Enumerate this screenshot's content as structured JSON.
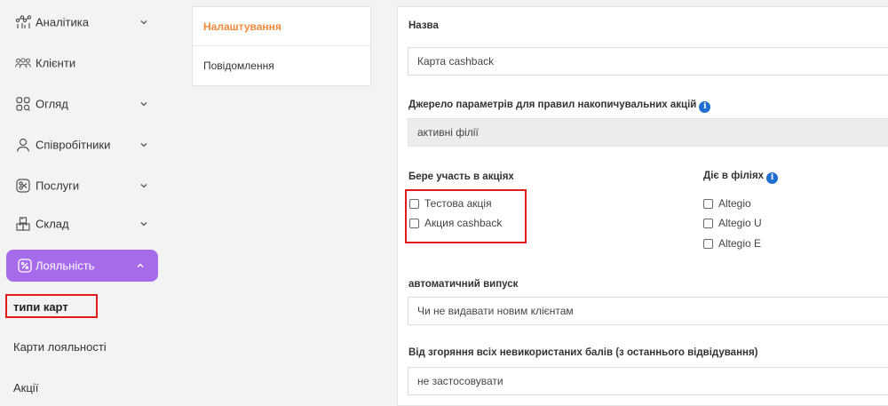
{
  "sidebar": {
    "items": [
      {
        "label": "Аналітика",
        "icon": "analytics-icon",
        "expandable": true
      },
      {
        "label": "Клієнти",
        "icon": "clients-icon",
        "expandable": false
      },
      {
        "label": "Огляд",
        "icon": "overview-icon",
        "expandable": true
      },
      {
        "label": "Співробітники",
        "icon": "employee-icon",
        "expandable": true
      },
      {
        "label": "Послуги",
        "icon": "services-icon",
        "expandable": true
      },
      {
        "label": "Склад",
        "icon": "warehouse-icon",
        "expandable": true
      },
      {
        "label": "Лояльність",
        "icon": "loyalty-icon",
        "expandable": true,
        "active": true
      }
    ],
    "sub_items": [
      "типи карт",
      "Карти лояльності",
      "Акції"
    ],
    "accent_color": "#a66bea"
  },
  "tabs": {
    "items": [
      "Налаштування",
      "Повідомлення"
    ],
    "active_color": "#f08a3c"
  },
  "form": {
    "name_label": "Назва",
    "name_value": "Карта cashback",
    "source_label": "Джерело параметрів для правил накопичувальних акцій",
    "source_value": "активні філії",
    "promos_label": "Бере участь в акціях",
    "promos": [
      "Тестова акція",
      "Акция cashback"
    ],
    "branches_label": "Діє в філіях",
    "branches": [
      "Altegio",
      "Altegio U",
      "Altegio E"
    ],
    "auto_issue_label": "автоматичний випуск",
    "auto_issue_value": "Чи не видавати новим клієнтам",
    "burn_label": "Від згоряння всіх невикористаних балів (з останнього відвідування)",
    "burn_value": "не застосовувати",
    "info_glyph": "i",
    "info_color": "#1f6fd1"
  },
  "highlight_color": "#e01b1b"
}
